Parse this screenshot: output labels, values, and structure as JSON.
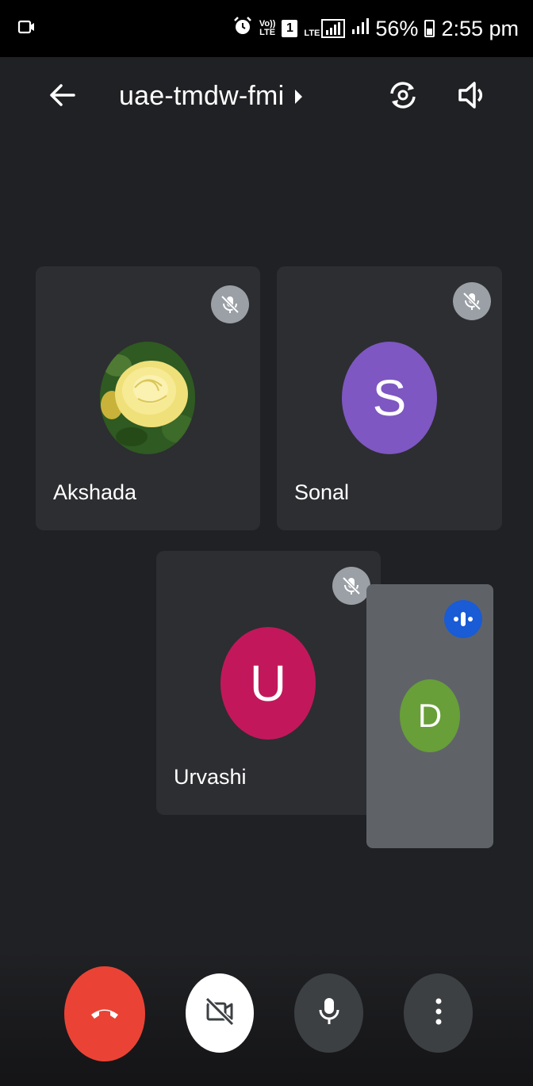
{
  "status_bar": {
    "icons": [
      "screen-record-icon",
      "alarm-icon",
      "volte-icon",
      "sim-1-icon",
      "lte-signal-icon",
      "signal-icon",
      "battery-icon"
    ],
    "volte_label_top": "Vo))",
    "volte_label_bottom": "LTE",
    "sim_label": "1",
    "lte_label": "LTE",
    "battery_percent": "56%",
    "time": "2:55 pm"
  },
  "toolbar": {
    "back_icon": "arrow-left-icon",
    "meeting_code": "uae-tmdw-fmi",
    "title_arrow_icon": "play-arrow-icon",
    "switch_camera_icon": "switch-camera-icon",
    "speaker_icon": "speaker-icon"
  },
  "participants": [
    {
      "name": "Akshada",
      "avatar_type": "photo-yellow-rose",
      "muted": true
    },
    {
      "name": "Sonal",
      "avatar_letter": "S",
      "avatar_color": "#7e57c2",
      "muted": true
    },
    {
      "name": "Urvashi",
      "avatar_letter": "U",
      "avatar_color": "#c2185b",
      "muted": true
    }
  ],
  "self_view": {
    "avatar_letter": "D",
    "avatar_color": "#689f38",
    "speaking_indicator_color": "#1a5bd6"
  },
  "controls": {
    "end_call": {
      "icon": "end-call-icon",
      "color": "#ea4335"
    },
    "camera": {
      "icon": "camera-off-icon",
      "color": "#ffffff"
    },
    "microphone": {
      "icon": "microphone-icon",
      "color": "#3c4043"
    },
    "more": {
      "icon": "more-vert-icon",
      "color": "#3c4043"
    }
  }
}
